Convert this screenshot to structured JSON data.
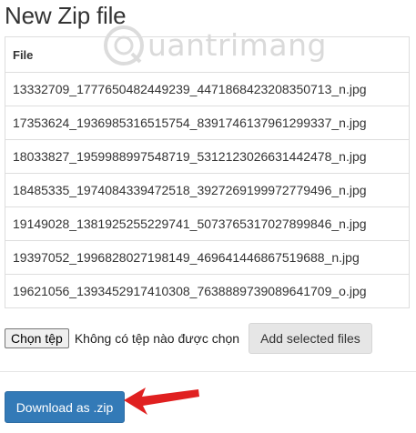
{
  "page": {
    "title": "New Zip file",
    "watermark_text": "uantrimang"
  },
  "table": {
    "header": "File",
    "files": [
      "13332709_1777650482449239_4471868423208350713_n.jpg",
      "17353624_1936985316515754_8391746137961299337_n.jpg",
      "18033827_1959988997548719_5312123026631442478_n.jpg",
      "18485335_1974084339472518_3927269199972779496_n.jpg",
      "19149028_1381925255229741_5073765317027899846_n.jpg",
      "19397052_1996828027198149_469641446867519688_n.jpg",
      "19621056_1393452917410308_7638889739089641709_o.jpg"
    ]
  },
  "upload": {
    "choose_label": "Chọn tệp",
    "no_file_text": "Không có tệp nào được chọn",
    "add_label": "Add selected files"
  },
  "download": {
    "label": "Download as .zip"
  },
  "colors": {
    "primary": "#337ab7",
    "arrow": "#e02020",
    "border": "#dddddd"
  }
}
